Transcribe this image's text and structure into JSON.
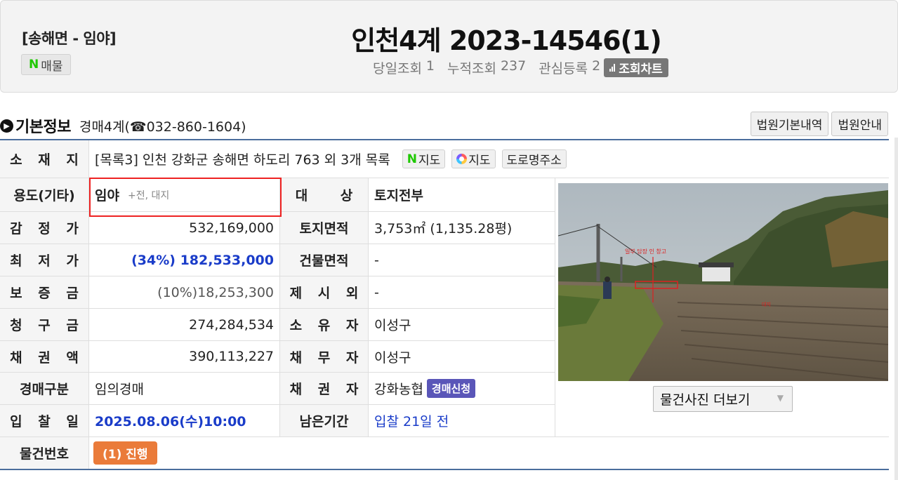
{
  "header": {
    "region": "[송해면 - 임야]",
    "naver_label": "매물",
    "case_title": "인천4계 2023-14546(1)",
    "stats": [
      {
        "label": "당일조회",
        "value": "1"
      },
      {
        "label": "누적조회",
        "value": "237"
      },
      {
        "label": "관심등록",
        "value": "2"
      }
    ],
    "chart_button": "조회차트"
  },
  "section": {
    "title": "기본정보",
    "contact": "경매4계(☎032-860-1604)",
    "buttons": [
      "법원기본내역",
      "법원안내"
    ]
  },
  "location": {
    "label": "소 재 지",
    "value": "[목록3] 인천 강화군 송해면 하도리 763 외 3개 목록",
    "naver_map": "지도",
    "daum_map": "지도",
    "road_address": "도로명주소"
  },
  "rows": {
    "usage": {
      "label": "용도(기타)",
      "value": "임야",
      "extra": "+전, 대지"
    },
    "target": {
      "label": "대 상",
      "value": "토지전부"
    },
    "appraisal": {
      "label": "감 정 가",
      "value": "532,169,000"
    },
    "land_area": {
      "label": "토지면적",
      "value": "3,753㎡ (1,135.28평)"
    },
    "min_price": {
      "label": "최 저 가",
      "value": "(34%) 182,533,000"
    },
    "building_area": {
      "label": "건물면적",
      "value": "-"
    },
    "deposit": {
      "label": "보 증 금",
      "value": "(10%)18,253,300"
    },
    "exclusion": {
      "label": "제 시 외",
      "value": "-"
    },
    "claim": {
      "label": "청 구 금",
      "value": "274,284,534"
    },
    "owner": {
      "label": "소 유 자",
      "value": "이성구"
    },
    "credit": {
      "label": "채 권 액",
      "value": "390,113,227"
    },
    "debtor": {
      "label": "채 무 자",
      "value": "이성구"
    },
    "auction_type": {
      "label": "경매구분",
      "value": "임의경매"
    },
    "creditor": {
      "label": "채 권 자",
      "value": "강화농협",
      "badge": "경매신청"
    },
    "bid_date": {
      "label": "입 찰 일",
      "value": "2025.08.06(수)10:00"
    },
    "remaining": {
      "label": "남은기간",
      "value": "입찰 21일 전"
    },
    "item_no": {
      "label": "물건번호",
      "badge": "(1) 진행"
    }
  },
  "photo": {
    "more_button": "물건사진 더보기"
  },
  "colors": {
    "accent_blue": "#1a3cc9",
    "table_border": "#4a6d9c",
    "badge_purple": "#5a56b8",
    "badge_orange": "#ea7b3a",
    "naver_green": "#1ec800",
    "highlight_red": "#e22222"
  }
}
